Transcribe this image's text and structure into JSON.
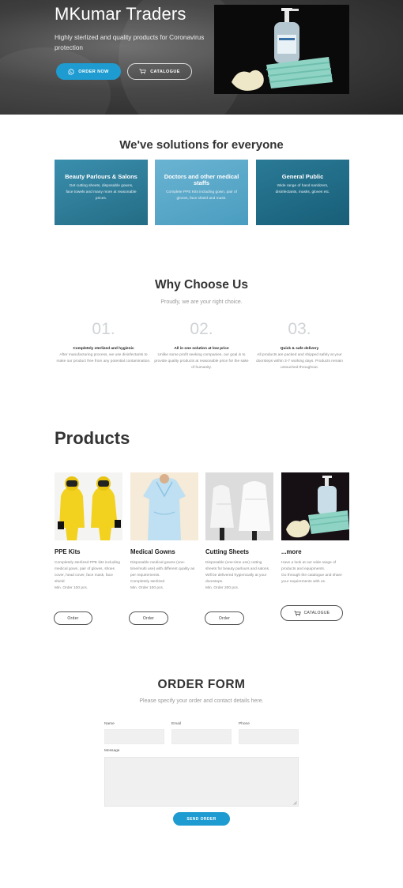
{
  "hero": {
    "title": "MKumar Traders",
    "subtitle": "Highly sterlized and quality products for Coronavirus protection",
    "order_button": "ORDER NOW",
    "catalogue_button": "CATALOGUE"
  },
  "solutions": {
    "title": "We've solutions for everyone",
    "cards": [
      {
        "title": "Beauty Parlours & Salons",
        "text": "Get cutting sheets, disposable gowns, face towels and many more at reasonable prices.",
        "color": "#2e7f9a"
      },
      {
        "title": "Doctors and other medical staffs",
        "text": "Complete PPE Kits including gown, pair of gloves, face shield and mask.",
        "color": "#5aa7c8"
      },
      {
        "title": "General Public",
        "text": "Wide range of hand sanitizers, disinfectants, masks, gloves etc.",
        "color": "#1f6b86"
      }
    ]
  },
  "why": {
    "title": "Why Choose Us",
    "subtitle": "Proudly, we are your right choice.",
    "items": [
      {
        "num": "01.",
        "head": "Completely sterlized and hygienic",
        "text": "After manufacturing process, we use disinfectants to make our product free from any potential contamination."
      },
      {
        "num": "02.",
        "head": "All in one solution at low price",
        "text": "Unlike some profit seeking companies, our goal is to provide quality products at reasonable price for the sake of humanity."
      },
      {
        "num": "03.",
        "head": "Quick & safe delivery",
        "text": "All products are packed and shipped safely at your doorsteps within 3-7 working days. Products remain untouched throughout."
      }
    ]
  },
  "products": {
    "title": "Products",
    "items": [
      {
        "name": "PPE Kits",
        "desc": "Completely sterlized PPE kits including medical gown, pair of gloves, shoes cover, head cover, face mask, face shield\nMin. Order 100 pcs.",
        "button": "Order"
      },
      {
        "name": "Medical Gowns",
        "desc": "Disposable medical gowns (one-time/multi use) with different quality as per requirements.\nCompletely sterlized\nMin. Order 100 pcs.",
        "button": "Order"
      },
      {
        "name": "Cutting Sheets",
        "desc": "Disposable (one-time use) cutting sheets for beauty parlours and salons.\nWill be delivered hygienically at your doorsteps.\nMin. Order 200 pcs.",
        "button": "Order"
      },
      {
        "name": "...more",
        "desc": "Have a look at our wide range of products and equipments.\nGo through the catalogue and share your requirements with us.",
        "button": "CATALOGUE"
      }
    ]
  },
  "order_form": {
    "title": "ORDER FORM",
    "subtitle": "Please specify your order and contact details here.",
    "name_label": "Name",
    "email_label": "Email",
    "phone_label": "Phone",
    "message_label": "Message",
    "submit": "SEND ORDER"
  },
  "colors": {
    "accent": "#1e9bd0"
  }
}
